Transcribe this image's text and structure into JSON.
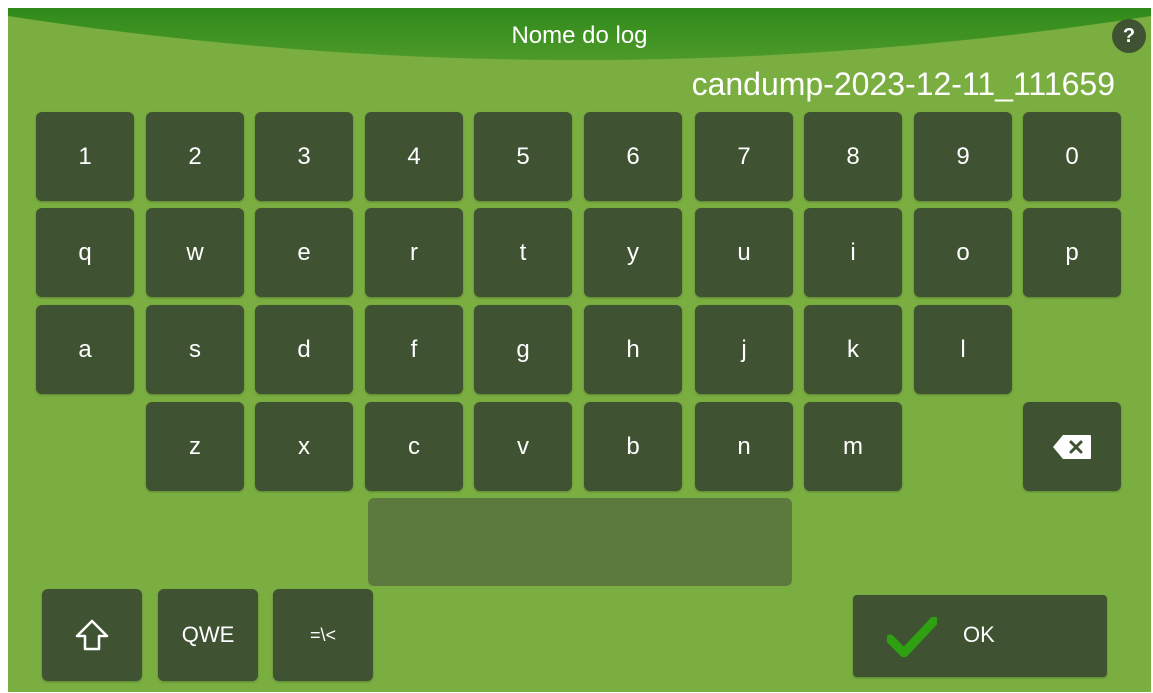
{
  "header": {
    "title": "Nome do log",
    "help_label": "?",
    "log_name": "candump-2023-12-11_111659"
  },
  "keyboard": {
    "rows": [
      [
        "1",
        "2",
        "3",
        "4",
        "5",
        "6",
        "7",
        "8",
        "9",
        "0"
      ],
      [
        "q",
        "w",
        "e",
        "r",
        "t",
        "y",
        "u",
        "i",
        "o",
        "p"
      ],
      [
        "a",
        "s",
        "d",
        "f",
        "g",
        "h",
        "j",
        "k",
        "l"
      ],
      [
        "z",
        "x",
        "c",
        "v",
        "b",
        "n",
        "m"
      ]
    ],
    "shift_icon": "shift-arrow-up-icon",
    "backspace_icon": "backspace-icon",
    "layout_button_label": "QWE",
    "symbols_button_label": "=\\<",
    "ok_label": "OK",
    "ok_icon": "checkmark-icon"
  },
  "colors": {
    "background": "#7aae41",
    "title_bar": "#3c8a1f",
    "key": "#3f5232",
    "space_key": "#5c7a3d",
    "checkmark": "#2fa012"
  }
}
